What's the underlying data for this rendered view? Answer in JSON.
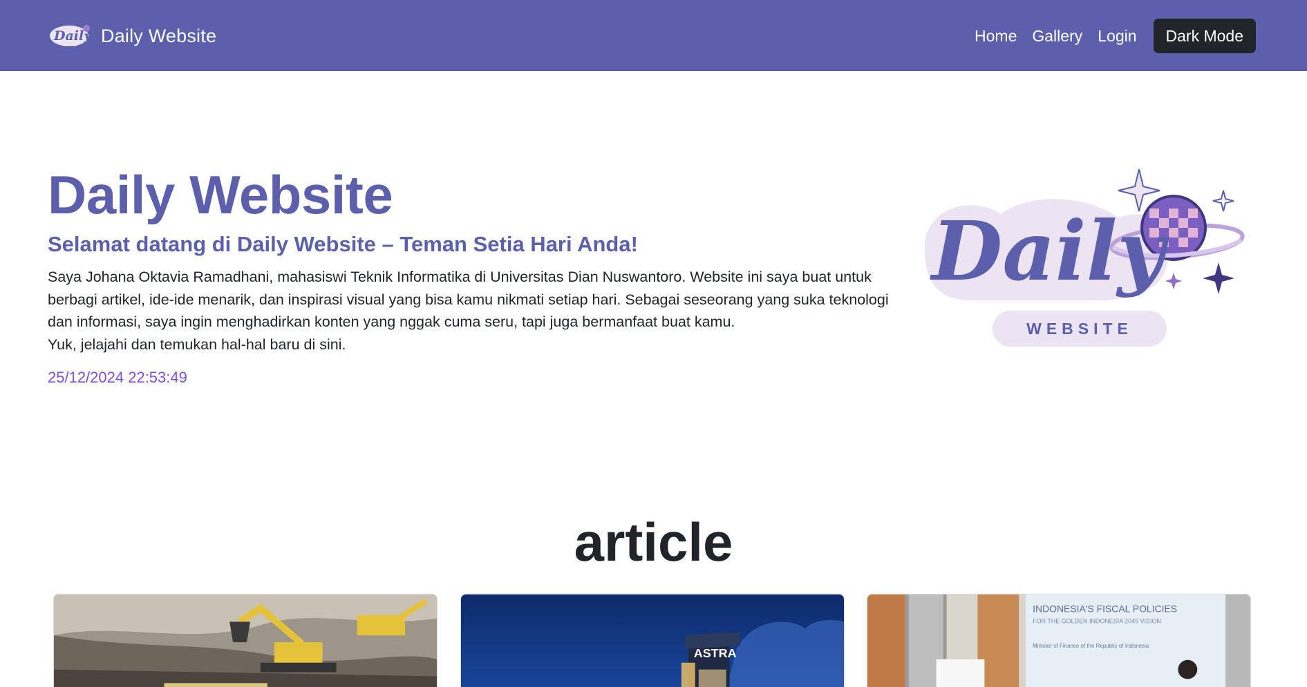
{
  "navbar": {
    "brand_text": "Daily Website",
    "links": [
      "Home",
      "Gallery",
      "Login"
    ],
    "dark_mode_label": "Dark Mode",
    "background": "#5c5fab"
  },
  "hero": {
    "title": "Daily Website",
    "subtitle": "Selamat datang di Daily Website – Teman Setia Hari Anda!",
    "description_1": "Saya Johana Oktavia Ramadhani, mahasiswi Teknik Informatika di Universitas Dian Nuswantoro. Website ini saya buat untuk berbagi artikel, ide-ide menarik, dan inspirasi visual yang bisa kamu nikmati setiap hari. Sebagai seseorang yang suka teknologi dan informasi, saya ingin menghadirkan konten yang nggak cuma seru, tapi juga bermanfaat buat kamu.",
    "description_2": "Yuk, jelajahi dan temukan hal-hal baru di sini.",
    "datetime": "25/12/2024 22:53:49",
    "logo": {
      "word": "Daily",
      "tagline": "WEBSITE"
    }
  },
  "article": {
    "heading": "article",
    "cards": [
      {
        "image": "excavator-mining-photo",
        "caption_text": ""
      },
      {
        "image": "astra-building-night-photo",
        "building_sign": "ASTRA"
      },
      {
        "image": "fiscal-policy-presentation-photo",
        "slide_title": "INDONESIA'S FISCAL POLICIES",
        "slide_subtitle": "FOR THE GOLDEN INDONESIA 2045 VISION",
        "slide_caption": "Minister of Finance of the Republic of Indonesia"
      }
    ]
  },
  "colors": {
    "accent": "#5c5fab",
    "datetime": "#7b4fd8",
    "dark_button": "#212529"
  }
}
